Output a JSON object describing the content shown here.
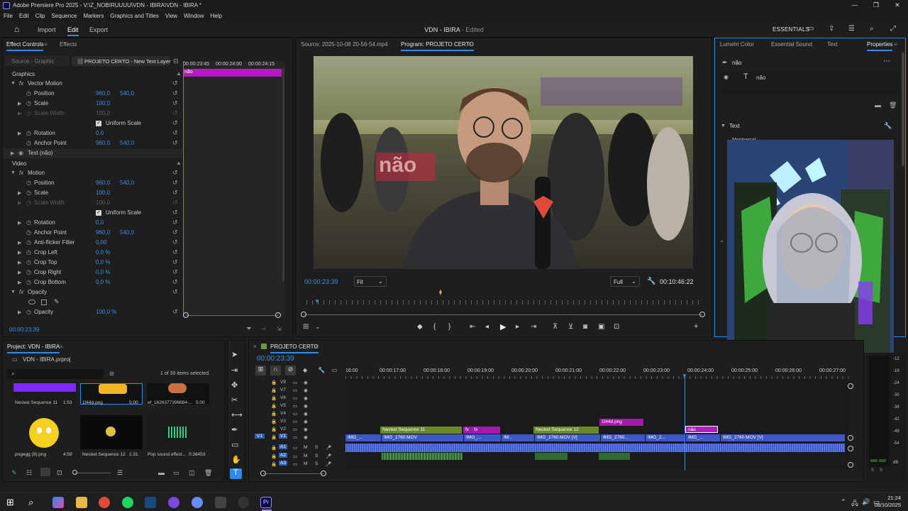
{
  "window": {
    "title": "Adobe Premiere Pro 2025 - V:\\Z_NOBIRUUUU\\VDN - IBIRA\\VDN - IBIRA *",
    "buttons": [
      "—",
      "❐",
      "✕"
    ]
  },
  "menu": [
    "File",
    "Edit",
    "Clip",
    "Sequence",
    "Markers",
    "Graphics and Titles",
    "View",
    "Window",
    "Help"
  ],
  "header": {
    "tabs": [
      "Import",
      "Edit",
      "Export"
    ],
    "active_tab": "Edit",
    "project_name": "VDN - IBIRA",
    "status": " - Edited",
    "workspace": "ESSENTIALS"
  },
  "effect_controls": {
    "tabs": [
      "Effect Controls",
      "Effects"
    ],
    "source": "Source - Graphic",
    "clip": "PROJETO CERTO - New Text Layer",
    "ruler": [
      "00:00:23:45",
      "00:00:24:00",
      "00:00:24:15"
    ],
    "clip_label": "não",
    "section_graphics": "Graphics",
    "vector_motion": "Vector Motion",
    "text_layer": "Text (não)",
    "section_video": "Video",
    "motion": "Motion",
    "params": {
      "position": {
        "label": "Position",
        "x": "960,0",
        "y": "540,0"
      },
      "scale": {
        "label": "Scale",
        "value": "100,0"
      },
      "scale_width": {
        "label": "Scale Width",
        "value": "100,0"
      },
      "uniform_scale": "Uniform Scale",
      "rotation": {
        "label": "Rotation",
        "value": "0,0"
      },
      "anchor_point": {
        "label": "Anchor Point",
        "x": "960,0",
        "y": "540,0"
      },
      "anti_flicker": {
        "label": "Anti-flicker Filter",
        "value": "0,00"
      },
      "crop_left": {
        "label": "Crop Left",
        "value": "0,0 %"
      },
      "crop_top": {
        "label": "Crop Top",
        "value": "0,0 %"
      },
      "crop_right": {
        "label": "Crop Right",
        "value": "0,0 %"
      },
      "crop_bottom": {
        "label": "Crop Bottom",
        "value": "0,0 %"
      },
      "opacity_section": "Opacity",
      "opacity": {
        "label": "Opacity",
        "value": "100,0 %"
      }
    },
    "timecode": "00:00:23:39"
  },
  "program_monitor": {
    "source_tab": "Source: 2025-10-08 20-56-54.mp4",
    "program_tab": "Program: PROJETO CERTO",
    "overlay_text": "não",
    "timecode": "00:00:23:39",
    "fit": "Fit",
    "quality": "Full",
    "duration": "00:10:46:22"
  },
  "properties": {
    "tabs": [
      "Lumetri Color",
      "Essential Sound",
      "Text",
      "Properties"
    ],
    "active_tab": "Properties",
    "layer_name": "não",
    "text_layer": "não",
    "text_section": "Text",
    "font": "Montserrat"
  },
  "project": {
    "title": "Project: VDN - IBIRA",
    "file": "VDN - IBIRA.prproj",
    "selection": "1 of 39 items selected",
    "items": [
      {
        "name": "Nested Sequence 11",
        "dur": "1:53"
      },
      {
        "name": "1f44d.png",
        "dur": "5:00"
      },
      {
        "name": "ef_1626377396684-...",
        "dur": "5:00"
      },
      {
        "name": "pngegg (9).png",
        "dur": "4:59"
      },
      {
        "name": "Nested Sequence 12",
        "dur": "1:31"
      },
      {
        "name": "Pop sound effect...",
        "dur": "0:38453"
      }
    ]
  },
  "timeline": {
    "sequence": "PROJETO CERTO",
    "timecode": "00:00:23:39",
    "ruler": [
      "16:00",
      "00:00:17:00",
      "00:00:18:00",
      "00:00:19:00",
      "00:00:20:00",
      "00:00:21:00",
      "00:00:22:00",
      "00:00:23:00",
      "00:00:24:00",
      "00:00:25:00",
      "00:00:26:00",
      "00:00:27:00"
    ],
    "video_tracks": [
      "V8",
      "V7",
      "V6",
      "V5",
      "V4",
      "V3",
      "V2",
      "V1"
    ],
    "audio_tracks": [
      "A1",
      "A2",
      "A3"
    ],
    "clips": {
      "nested11": "Nested Sequence 11",
      "nested12": "Nested Sequence 12",
      "png": "1f44d.png",
      "nao": "não",
      "v1_a": "IMG_2760.MOV",
      "v1_b": "IMG_...",
      "v1_c": "IM...",
      "v1_d": "IMG_2760.MOV [V]",
      "v1_e": "IMG_2760...",
      "v1_f": "IMG_2...",
      "v1_g": "IMG_...",
      "v1_h": "IMG_2760.MOV [V]",
      "v1_0": "IMG_..."
    }
  },
  "audio_meter": {
    "scale": [
      "-12",
      "-18",
      "-24",
      "-30",
      "-36",
      "-42",
      "-48",
      "-54",
      "dB"
    ],
    "footer": [
      "S",
      "S"
    ]
  },
  "taskbar": {
    "time": "21:24",
    "date": "08/10/2025"
  },
  "colors": {
    "accent": "#2d8ceb",
    "clip_magenta": "#b21cbe",
    "clip_green": "#6a8a2a",
    "clip_blue": "#3d56c9",
    "audio_green": "#3f7a3a"
  }
}
